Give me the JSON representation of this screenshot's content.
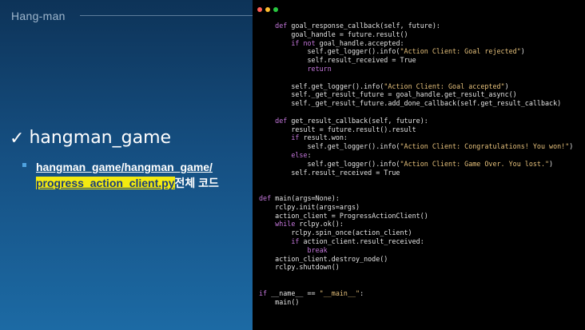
{
  "slide": {
    "title": "Hang-man",
    "bullet1": "hangman_game",
    "bullet2_link_a": "hangman_game/hangman_game/",
    "bullet2_link_b": "progress_action_client.py",
    "bullet2_rest": "전체 코드"
  },
  "window": {
    "dot_colors": [
      "#ff5f57",
      "#febc2e",
      "#28c840"
    ]
  },
  "code_lines": [
    "    def goal_response_callback(self, future):",
    "        goal_handle = future.result()",
    "        if not goal_handle.accepted:",
    "            self.get_logger().info(\"Action Client: Goal rejected\")",
    "            self.result_received = True",
    "            return",
    "",
    "        self.get_logger().info(\"Action Client: Goal accepted\")",
    "        self._get_result_future = goal_handle.get_result_async()",
    "        self._get_result_future.add_done_callback(self.get_result_callback)",
    "",
    "    def get_result_callback(self, future):",
    "        result = future.result().result",
    "        if result.won:",
    "            self.get_logger().info(\"Action Client: Congratulations! You won!\")",
    "        else:",
    "            self.get_logger().info(\"Action Client: Game Over. You lost.\")",
    "        self.result_received = True",
    "",
    "",
    "def main(args=None):",
    "    rclpy.init(args=args)",
    "    action_client = ProgressActionClient()",
    "    while rclpy.ok():",
    "        rclpy.spin_once(action_client)",
    "        if action_client.result_received:",
    "            break",
    "    action_client.destroy_node()",
    "    rclpy.shutdown()",
    "",
    "",
    "if __name__ == \"__main__\":",
    "    main()"
  ]
}
